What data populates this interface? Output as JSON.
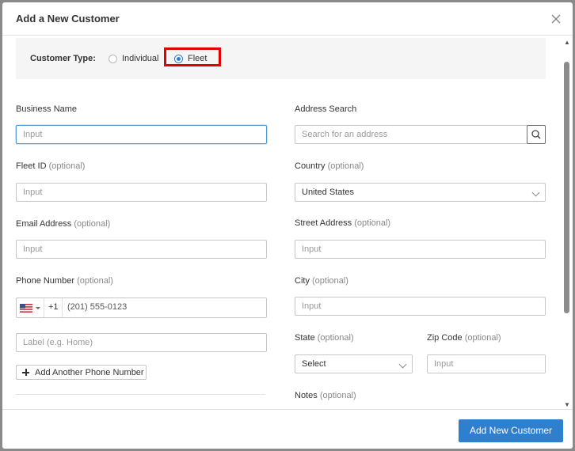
{
  "modal": {
    "title": "Add a New Customer",
    "close_icon": "close-icon"
  },
  "customer_type": {
    "label": "Customer Type:",
    "options": [
      {
        "label": "Individual",
        "selected": false
      },
      {
        "label": "Fleet",
        "selected": true
      }
    ]
  },
  "left": {
    "business_name": {
      "label": "Business Name",
      "placeholder": "Input"
    },
    "fleet_id": {
      "label": "Fleet ID",
      "optional": "(optional)",
      "placeholder": "Input"
    },
    "email": {
      "label": "Email Address",
      "optional": "(optional)",
      "placeholder": "Input"
    },
    "phone": {
      "label": "Phone Number",
      "optional": "(optional)",
      "country_flag": "us-flag-icon",
      "dial_code": "+1",
      "placeholder": "(201) 555-0123",
      "label_placeholder": "Label (e.g. Home)"
    },
    "add_phone_label": "Add Another Phone Number"
  },
  "right": {
    "address_search": {
      "label": "Address Search",
      "placeholder": "Search for an address",
      "icon": "search-icon"
    },
    "country": {
      "label": "Country",
      "optional": "(optional)",
      "value": "United States"
    },
    "street": {
      "label": "Street Address",
      "optional": "(optional)",
      "placeholder": "Input"
    },
    "city": {
      "label": "City",
      "optional": "(optional)",
      "placeholder": "Input"
    },
    "state": {
      "label": "State",
      "optional": "(optional)",
      "value": "Select"
    },
    "zip": {
      "label": "Zip Code",
      "optional": "(optional)",
      "placeholder": "Input"
    },
    "notes": {
      "label": "Notes",
      "optional": "(optional)"
    }
  },
  "footer": {
    "primary_label": "Add New Customer"
  },
  "colors": {
    "accent": "#2f7fcf",
    "highlight": "#e00000",
    "focus_border": "#4d9ed8"
  }
}
